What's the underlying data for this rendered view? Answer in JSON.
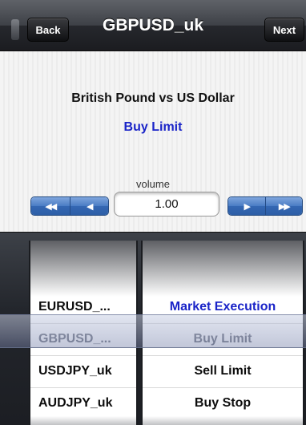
{
  "navbar": {
    "title": "GBPUSD_uk",
    "back_label": "Back",
    "next_label": "Next"
  },
  "info": {
    "instrument_name": "British Pound vs US Dollar",
    "order_type": "Buy Limit"
  },
  "volume": {
    "label": "volume",
    "value": "1.00",
    "decrease_fast_icon": "double-left-arrow-icon",
    "decrease_icon": "left-arrow-icon",
    "increase_icon": "right-arrow-icon",
    "increase_fast_icon": "double-right-arrow-icon",
    "decrease_fast_glyph": "◀◀",
    "decrease_glyph": "◀",
    "increase_glyph": "▶",
    "increase_fast_glyph": "▶▶"
  },
  "picker": {
    "symbols": [
      "EURUSD_...",
      "GBPUSD_...",
      "USDJPY_uk",
      "AUDJPY_uk"
    ],
    "order_types": [
      "Market Execution",
      "Buy Limit",
      "Sell Limit",
      "Buy Stop"
    ],
    "selected_index": 1
  },
  "colors": {
    "accent_blue": "#1a24c8",
    "stepper_blue": "#4a7cc4",
    "navbar_dark": "#26282d"
  }
}
